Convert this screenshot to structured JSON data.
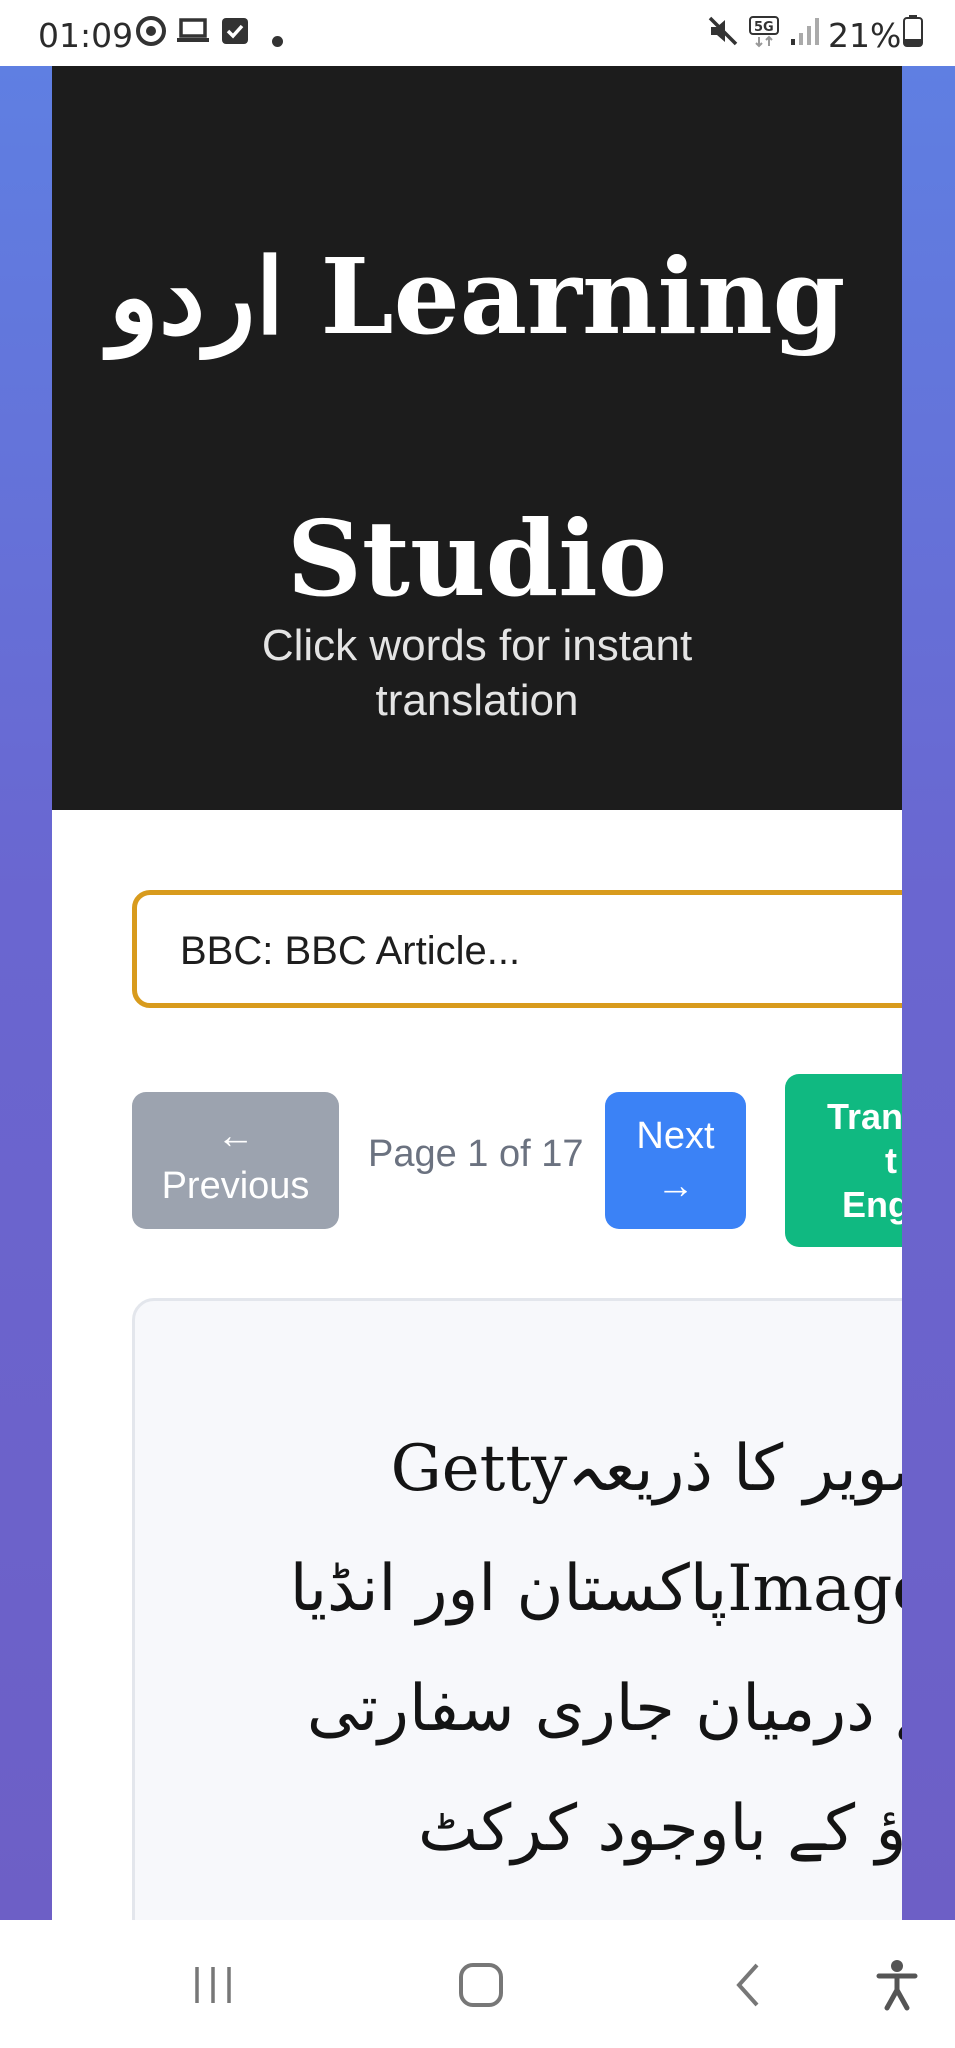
{
  "status_bar": {
    "time": "01:09",
    "battery": "21%",
    "icons": [
      "at-sign-icon",
      "laptop-icon",
      "checkbox-icon",
      "dot-icon",
      "mute-icon",
      "5g-icon",
      "signal-icon",
      "battery-icon"
    ]
  },
  "header": {
    "title_urdu": "اردو",
    "title_line1": "Learning",
    "title_line2": "Studio",
    "subtitle": "Click words for instant translation"
  },
  "article_select": {
    "value": "BBC: BBC Article..."
  },
  "pagination": {
    "prev_arrow": "←",
    "prev_label": "Previous",
    "page_info": "Page 1 of 17",
    "next_label": "Next",
    "next_arrow": "→",
    "translate_line1": "Tran",
    "translate_line2": "t",
    "translate_line3": "Eng"
  },
  "article": {
    "lines": [
      "تصویر کا ذریعہGetty",
      "Imagesپاکستان اور انڈیا",
      "کے درمیان جاری سفارتی",
      "تناؤ کے باوجود کرکٹ"
    ]
  },
  "colors": {
    "header_bg": "#1c1c1c",
    "select_border": "#d89b1d",
    "prev_button": "#9ca3af",
    "next_button": "#3b82f6",
    "translate_button": "#10b981",
    "app_background": "#6a66d0"
  },
  "nav_bar": {
    "icons": [
      "recent-apps-icon",
      "home-icon",
      "back-icon",
      "accessibility-icon"
    ]
  }
}
